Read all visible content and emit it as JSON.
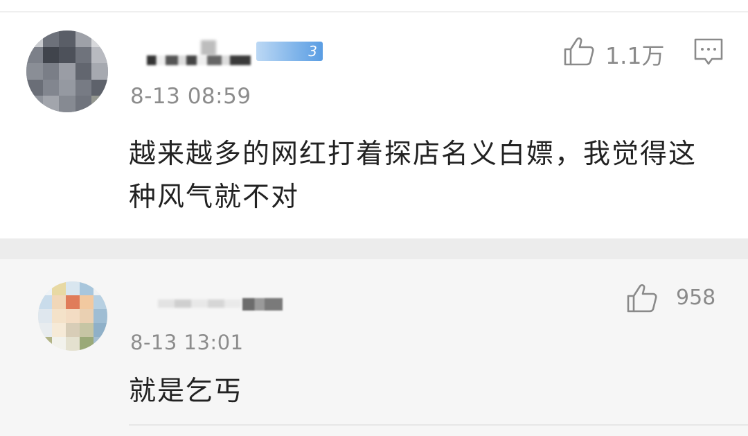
{
  "comments": [
    {
      "timestamp": "8-13 08:59",
      "text": "越来越多的网红打着探店名义白嫖，我觉得这种风气就不对",
      "likes": "1.1万",
      "level_badge": "3",
      "avatar_icon": "blurred-avatar"
    },
    {
      "timestamp": "8-13 13:01",
      "text": "就是乞丐",
      "likes": "958",
      "avatar_icon": "blurred-avatar"
    }
  ],
  "icons": {
    "like": "thumbs-up-icon",
    "reply": "comment-bubble-icon"
  },
  "colors": {
    "text_primary": "#222222",
    "text_secondary": "#8c8c8c",
    "reply_bg": "#f6f6f6",
    "badge": "#7fb4ea"
  }
}
